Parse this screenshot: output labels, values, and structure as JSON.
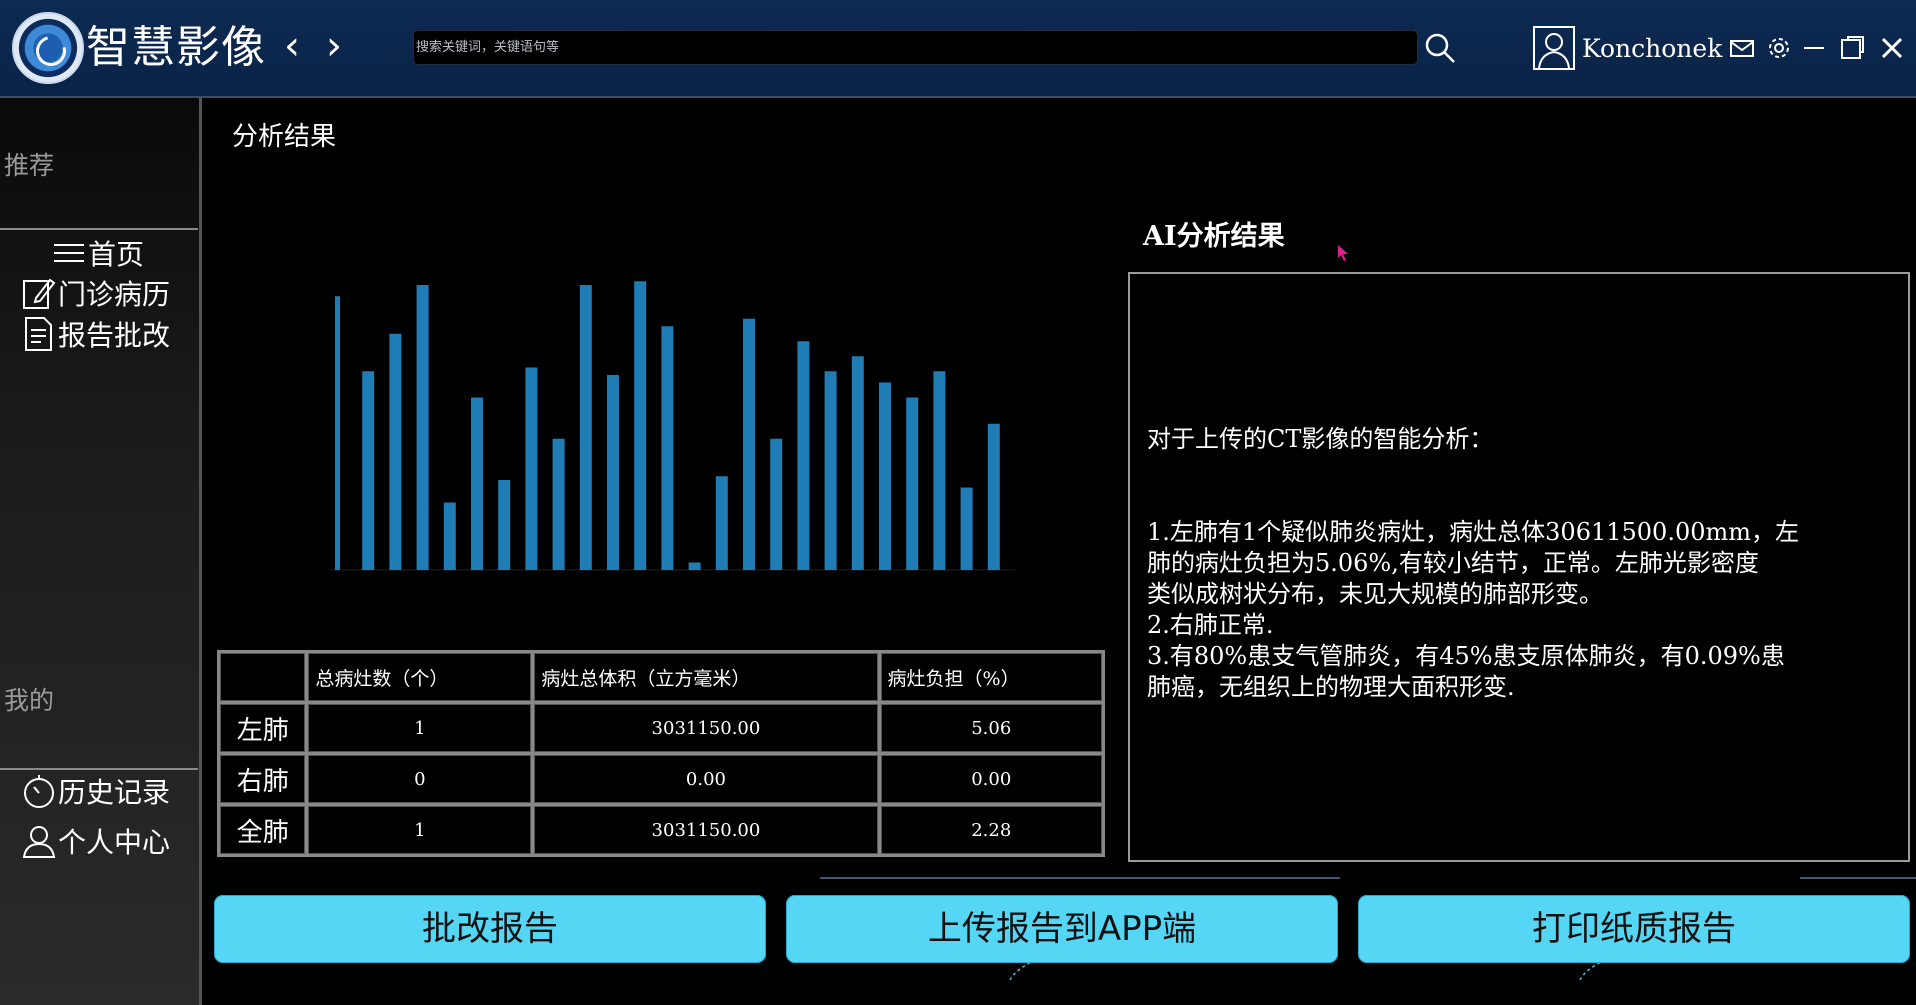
{
  "app": {
    "title": "智慧影像",
    "user": "Konchonek"
  },
  "search": {
    "placeholder": "搜索关键词，关键语句等"
  },
  "sidebar": {
    "recommend_heading": "推荐",
    "mine_heading": "我的",
    "items": [
      {
        "label": "首页",
        "icon": "menu-icon"
      },
      {
        "label": "门诊病历",
        "icon": "edit-icon"
      },
      {
        "label": "报告批改",
        "icon": "document-icon"
      }
    ],
    "mine_items": [
      {
        "label": "历史记录",
        "icon": "stopwatch-icon"
      },
      {
        "label": "个人中心",
        "icon": "user-icon"
      }
    ]
  },
  "main": {
    "section_title": "分析结果"
  },
  "chart_data": {
    "type": "bar",
    "values": [
      73,
      53,
      63,
      76,
      18,
      46,
      24,
      54,
      35,
      76,
      52,
      77,
      65,
      2,
      25,
      67,
      35,
      61,
      53,
      57,
      50,
      46,
      53,
      22,
      39
    ],
    "bar_color": "#1f7cb5",
    "title": "",
    "xlabel": "",
    "ylabel": ""
  },
  "table": {
    "headers": [
      "",
      "总病灶数（个）",
      "病灶总体积（立方毫米）",
      "病灶负担（%）"
    ],
    "rows": [
      [
        "左肺",
        "1",
        "3031150.00",
        "5.06"
      ],
      [
        "右肺",
        "0",
        "0.00",
        "0.00"
      ],
      [
        "全肺",
        "1",
        "3031150.00",
        "2.28"
      ]
    ]
  },
  "ai": {
    "title": "AI分析结果",
    "intro": "对于上传的CT影像的智能分析：",
    "lines": [
      "1.左肺有1个疑似肺炎病灶，病灶总体30611500.00mm，左",
      "肺的病灶负担为5.06%,有较小结节，正常。左肺光影密度",
      "类似成树状分布，未见大规模的肺部形变。",
      "2.右肺正常.",
      "3.有80%患支气管肺炎，有45%患支原体肺炎，有0.09%患",
      "肺癌，无组织上的物理大面积形变."
    ]
  },
  "buttons": {
    "review": "批改报告",
    "upload": "上传报告到APP端",
    "print": "打印纸质报告"
  },
  "colors": {
    "titlebar": "#0d2a52",
    "button": "#55d6f4",
    "bar": "#1f7cb5"
  }
}
